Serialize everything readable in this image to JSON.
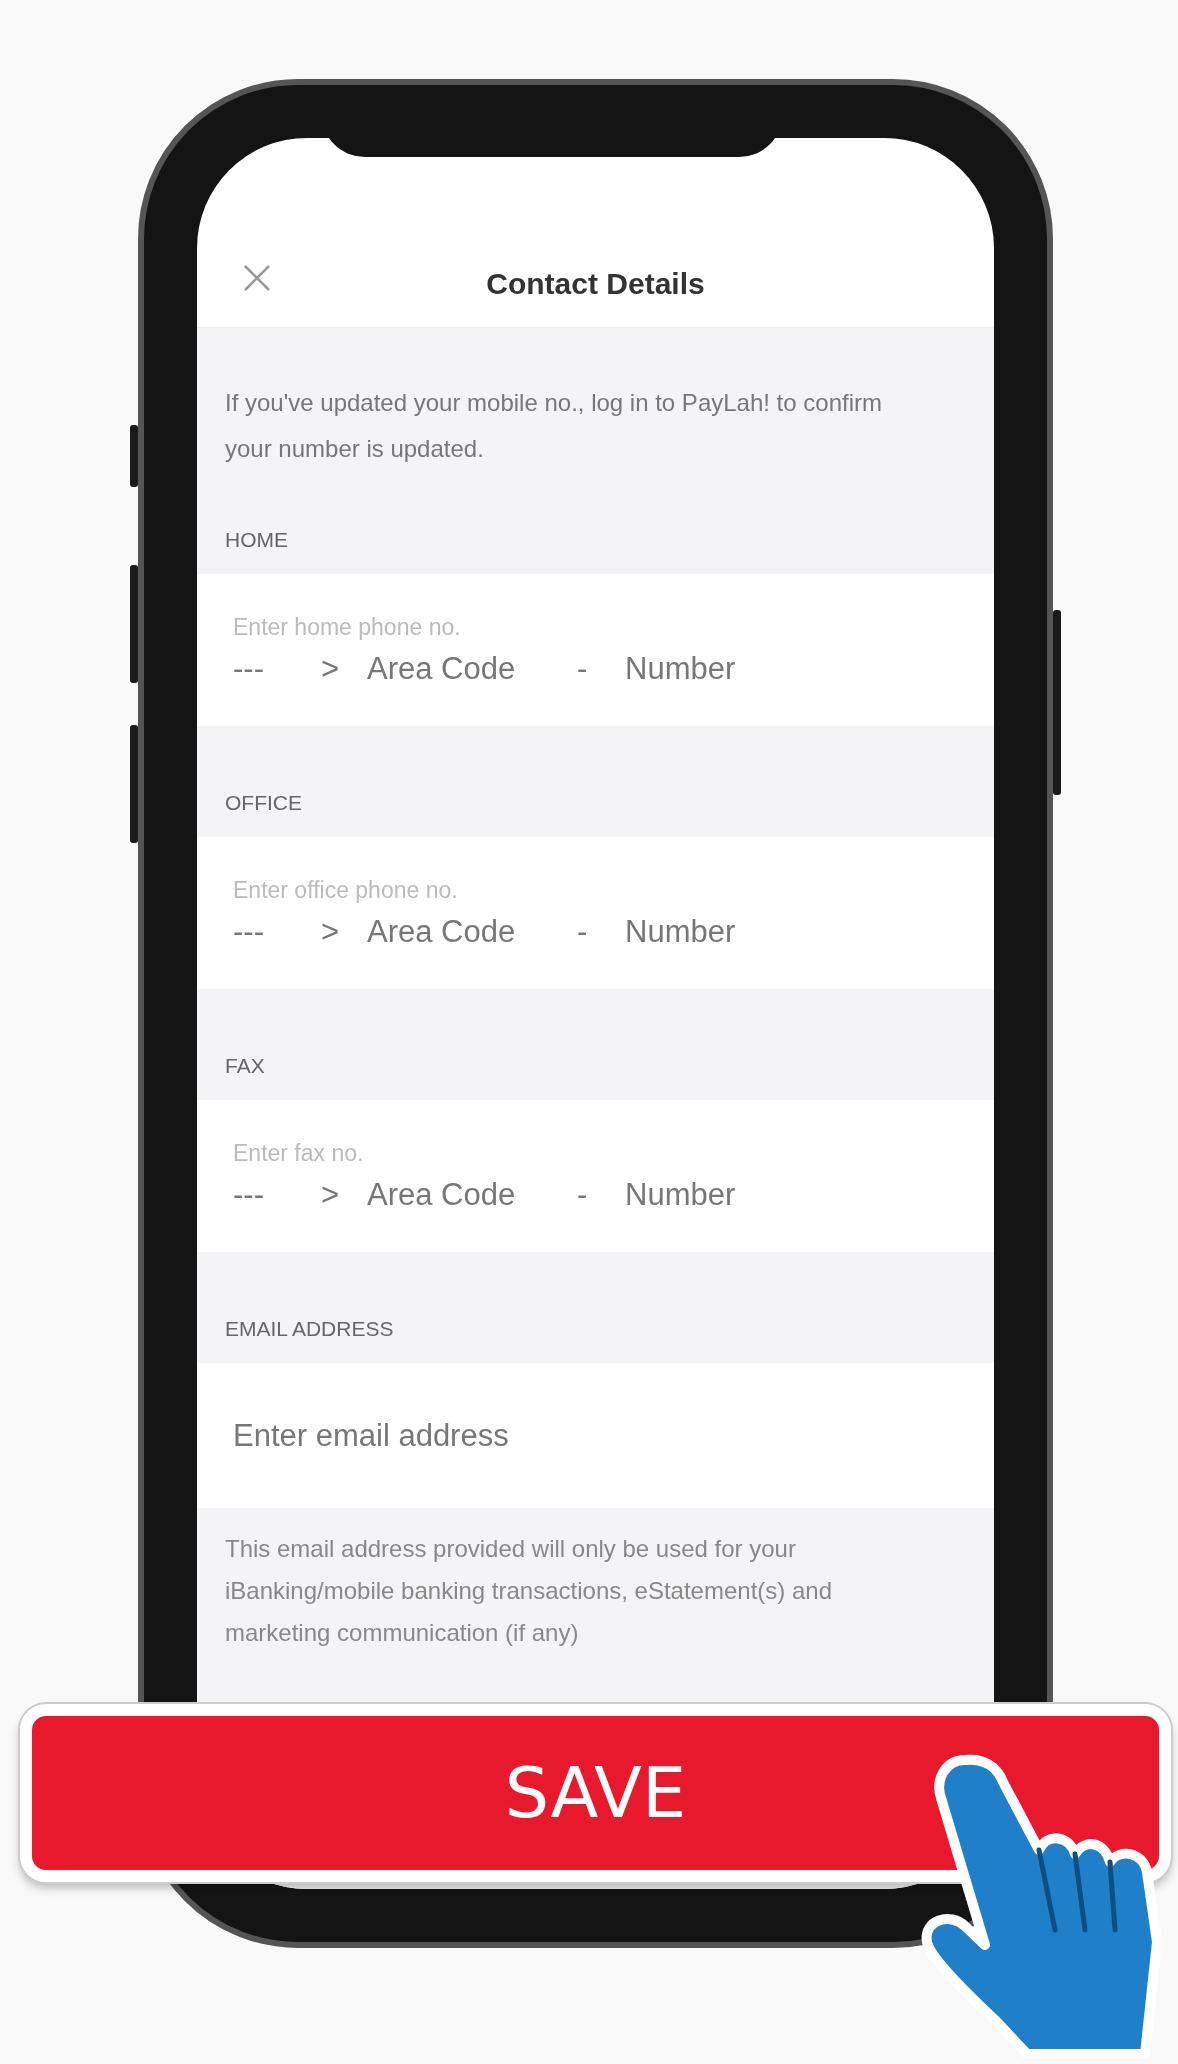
{
  "header": {
    "title": "Contact Details"
  },
  "notice": "If you've updated your mobile no., log in to PayLah! to confirm your number is updated.",
  "sections": [
    {
      "label": "HOME",
      "kind": "phone",
      "placeholder": "Enter home phone no.",
      "country_code": "---",
      "chevron": ">",
      "area_code": "Area Code",
      "dash": "-",
      "number": "Number"
    },
    {
      "label": "OFFICE",
      "kind": "phone",
      "placeholder": "Enter office phone no.",
      "country_code": "---",
      "chevron": ">",
      "area_code": "Area Code",
      "dash": "-",
      "number": "Number"
    },
    {
      "label": "FAX",
      "kind": "phone",
      "placeholder": "Enter fax no.",
      "country_code": "---",
      "chevron": ">",
      "area_code": "Area Code",
      "dash": "-",
      "number": "Number"
    },
    {
      "label": "EMAIL ADDRESS",
      "kind": "email",
      "placeholder": "Enter email address",
      "note": "This email address provided will only be used for your iBanking/mobile banking transactions, eStatement(s) and marketing communication (if any)"
    }
  ],
  "save_button": "SAVE"
}
